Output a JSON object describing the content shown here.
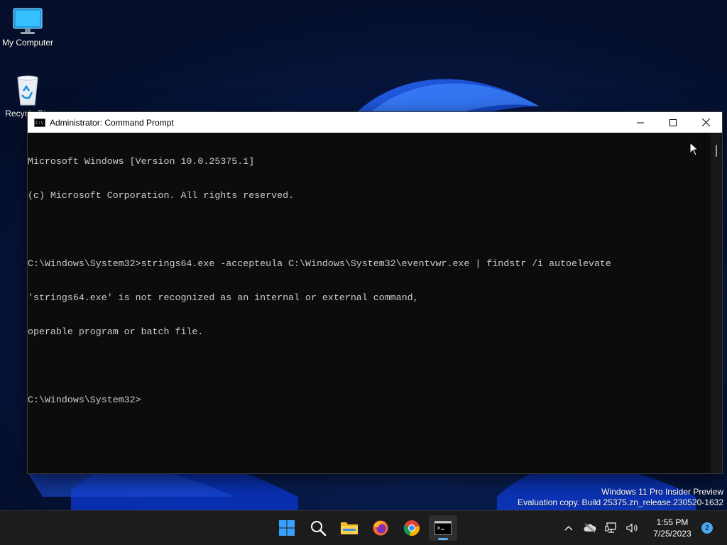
{
  "desktop": {
    "icons": [
      {
        "label": "My Computer"
      },
      {
        "label": "Recycle Bin"
      }
    ]
  },
  "window": {
    "title": "Administrator: Command Prompt",
    "console_lines": [
      "Microsoft Windows [Version 10.0.25375.1]",
      "(c) Microsoft Corporation. All rights reserved.",
      "",
      "C:\\Windows\\System32>strings64.exe -accepteula C:\\Windows\\System32\\eventvwr.exe | findstr /i autoelevate",
      "'strings64.exe' is not recognized as an internal or external command,",
      "operable program or batch file.",
      "",
      "C:\\Windows\\System32>"
    ]
  },
  "watermark": {
    "line1": "Windows 11 Pro Insider Preview",
    "line2": "Evaluation copy. Build 25375.zn_release.230520-1632"
  },
  "taskbar": {
    "apps": [
      "start-icon",
      "search-icon",
      "file-explorer-icon",
      "firefox-icon",
      "chrome-icon",
      "command-prompt-icon"
    ],
    "clock_time": "1:55 PM",
    "clock_date": "7/25/2023",
    "notification_count": "2"
  },
  "colors": {
    "console_bg": "#0c0c0c",
    "console_text": "#cccccc",
    "taskbar_bg": "#1c1c1c",
    "accent": "#4aa8ec"
  }
}
